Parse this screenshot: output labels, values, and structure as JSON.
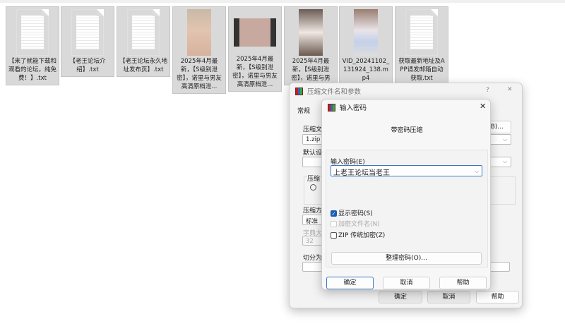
{
  "files": [
    {
      "name": "【来了就能下载和观看的论坛，纯免费！】.txt",
      "type": "txt"
    },
    {
      "name": "【老王论坛介绍】.txt",
      "type": "txt"
    },
    {
      "name": "【老王论坛永久地址发布页】.txt",
      "type": "txt"
    },
    {
      "name": "2025年4月最新，【S级别泄密】，诺里与男友高清原档泄...",
      "type": "video"
    },
    {
      "name": "2025年4月最新，【S级别泄密】，诺里与男友高清原档泄...",
      "type": "video-film"
    },
    {
      "name": "2025年4月最新，【S级别泄密】，诺里与男",
      "type": "video"
    },
    {
      "name": "VID_20241102_131924_138.mp4",
      "type": "video"
    },
    {
      "name": "获取最新地址及APP请发邮箱自动获取.txt",
      "type": "txt"
    }
  ],
  "archive_dialog": {
    "title": "压缩文件名和参数",
    "help": "?",
    "close": "✕",
    "tab": "常规",
    "archive_name_label": "压缩文",
    "archive_name": "1.zip",
    "browse": "(B)...",
    "profile_label": "默认设",
    "format_group": "压缩",
    "method_label": "压缩方",
    "method": "标准",
    "dict_label": "字典大",
    "dict": "32",
    "split_label": "切分为",
    "ok": "确定",
    "cancel": "取消",
    "help_btn": "帮助"
  },
  "password_dialog": {
    "title": "输入密码",
    "close": "✕",
    "heading": "带密码压缩",
    "password_label": "输入密码(E)",
    "password": "上老王论坛当老王",
    "show_password": {
      "label": "显示密码(S)",
      "checked": true
    },
    "encrypt_names": {
      "label": "加密文件名(N)",
      "checked": false,
      "disabled": true
    },
    "zip_legacy": {
      "label": "ZIP 传统加密(Z)",
      "checked": false
    },
    "organize": "整理密码(O)...",
    "ok": "确定",
    "cancel": "取消",
    "help": "帮助"
  }
}
